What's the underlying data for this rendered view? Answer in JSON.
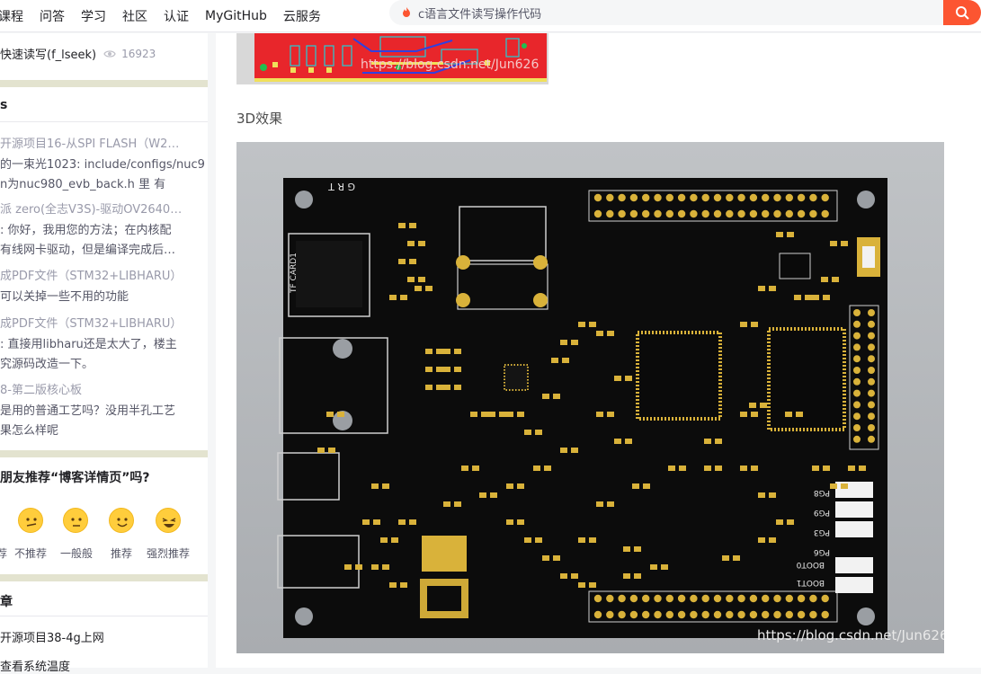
{
  "nav": {
    "items": [
      "课程",
      "问答",
      "学习",
      "社区",
      "认证",
      "MyGitHub",
      "云服务"
    ]
  },
  "search": {
    "value": "c语言文件读写操作代码"
  },
  "sidebar": {
    "top_item": {
      "title": "快速读写(f_lseek)",
      "views": "16923"
    },
    "comments_title": "s",
    "comments": [
      {
        "title": "开源项目16-从SPI FLASH（W2…",
        "lines": [
          "的一束光1023: include/configs/nuc9",
          "n为nuc980_evb_back.h 里 有"
        ]
      },
      {
        "title": "派 zero(全志V3S)-驱动OV2640…",
        "lines": [
          ": 你好，我用您的方法；在内核配",
          "有线网卡驱动，但是编译完成后…"
        ]
      },
      {
        "title": "成PDF文件（STM32+LIBHARU）",
        "lines": [
          "可以关掉一些不用的功能"
        ]
      },
      {
        "title": "成PDF文件（STM32+LIBHARU）",
        "lines": [
          ": 直接用libharu还是太大了，楼主",
          "究源码改造一下。"
        ]
      },
      {
        "title": "8-第二版核心板",
        "lines": [
          "是用的普通工艺吗？没用半孔工艺",
          "果怎么样呢"
        ]
      }
    ],
    "recommend": {
      "title": "朋友推荐“博客详情页”吗?",
      "options": [
        "荐",
        "不推荐",
        "一般般",
        "推荐",
        "强烈推荐"
      ]
    },
    "latest": {
      "title": "章",
      "items": [
        "开源项目38-4g上网",
        "查看系统温度"
      ]
    }
  },
  "article": {
    "section_label": "3D效果",
    "watermark_top": "https://blog.csdn.net/Jun626",
    "watermark_bottom": "https://blog.csdn.net/Jun626",
    "board_labels": {
      "header": "G R T",
      "tf": "TF CARD1",
      "pins_right": [
        "PG8",
        "PG9",
        "PG3",
        "PG6"
      ],
      "boot": [
        "BOOT0",
        "BOOT1"
      ]
    }
  },
  "colors": {
    "accent": "#fc5531",
    "pcb_black": "#0c0c0c",
    "gold": "#d9b23a",
    "sidebar_bg": "#e3e3cf"
  }
}
